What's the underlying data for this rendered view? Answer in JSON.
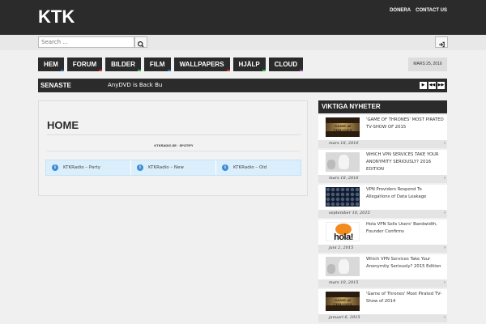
{
  "header": {
    "logo": "KTK",
    "links": [
      "DONERA",
      "CONTACT US"
    ]
  },
  "search": {
    "placeholder": "Search ..."
  },
  "nav": {
    "items": [
      {
        "label": "HEM",
        "stripe": "#1e73be"
      },
      {
        "label": "FORUM",
        "stripe": "#e02b2b"
      },
      {
        "label": "BILDER",
        "stripe": "#2eb82e"
      },
      {
        "label": "FILM",
        "stripe": "#1e73be"
      },
      {
        "label": "WALLPAPERS",
        "stripe": "#e02b2b"
      },
      {
        "label": "HJÄLP",
        "stripe": "#2eb82e"
      },
      {
        "label": "CLOUD",
        "stripe": "#8e44ad"
      }
    ],
    "date": "MARS 25, 2016"
  },
  "ticker": {
    "label": "SENASTE",
    "text": "AnyDVD is Back Bu",
    "controls": [
      "▶",
      "◀◀",
      "▶▶"
    ]
  },
  "main": {
    "title": "HOME",
    "breadcrumb": "KTKRADIO.SE · SPOTIFY",
    "tabs": [
      "KTKRadio – Party",
      "KTKRadio – New",
      "KTKRadio – Old"
    ]
  },
  "sidebar": {
    "heading": "VIKTIGA NYHETER",
    "items": [
      {
        "title": "'GAME OF THRONES' MOST PIRATED TV-SHOW OF 2015",
        "date": "mars 18, 2016",
        "thumb": "got",
        "thumb_text": "GAME of THRONES"
      },
      {
        "title": "WHICH VPN SERVICES TAKE YOUR ANONYMITY SERIOUSLY? 2016 EDITION",
        "date": "mars 18, 2016",
        "thumb": "grey",
        "thumb_text": ""
      },
      {
        "title": "VPN Providers Respond To Allegations of Data Leakage",
        "date": "september 10, 2015",
        "thumb": "dots",
        "thumb_text": ""
      },
      {
        "title": "Hola VPN Sells Users' Bandwidth, Founder Confirms",
        "date": "juni 2, 2015",
        "thumb": "hola",
        "thumb_text": "hola!"
      },
      {
        "title": "Which VPN Services Take Your Anonymity Seriously? 2015 Edition",
        "date": "mars 10, 2015",
        "thumb": "grey",
        "thumb_text": ""
      },
      {
        "title": "'Game of Thrones' Most Pirated TV-Show of 2014",
        "date": "januari 6, 2015",
        "thumb": "got",
        "thumb_text": "GAME of THRONES"
      }
    ]
  },
  "colors": {
    "dark": "#2b2b2b",
    "info_bg": "#dbeefb",
    "info_icon": "#3b8dd6"
  },
  "icons": {
    "search": "magnifier-icon",
    "login": "sign-in-icon",
    "info": "info-icon",
    "arrow": "chevron-right-icon"
  }
}
